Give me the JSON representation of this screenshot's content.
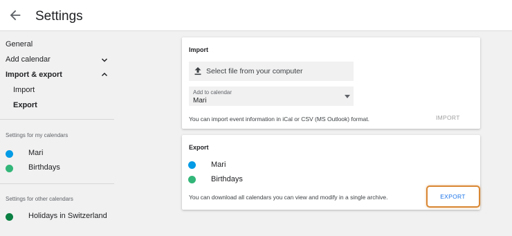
{
  "header": {
    "title": "Settings",
    "back_icon": "arrow-left-icon"
  },
  "sidebar": {
    "items": [
      {
        "label": "General"
      },
      {
        "label": "Add calendar",
        "icon": "chevron-down-icon"
      },
      {
        "label": "Import & export",
        "icon": "chevron-up-icon"
      },
      {
        "label": "Import"
      },
      {
        "label": "Export"
      }
    ],
    "my_calendars": {
      "label": "Settings for my calendars",
      "items": [
        {
          "name": "Mari",
          "color": "#039be5"
        },
        {
          "name": "Birthdays",
          "color": "#33b679"
        }
      ]
    },
    "other_calendars": {
      "label": "Settings for other calendars",
      "items": [
        {
          "name": "Holidays in Switzerland",
          "color": "#0b8043"
        }
      ]
    }
  },
  "import": {
    "title": "Import",
    "file_label": "Select file from your computer",
    "file_icon": "upload-icon",
    "add_to_label": "Add to calendar",
    "add_to_value": "Mari",
    "info": "You can import event information in iCal or CSV (MS Outlook) format.",
    "button": "IMPORT"
  },
  "export": {
    "title": "Export",
    "calendars": [
      {
        "name": "Mari",
        "color": "#039be5"
      },
      {
        "name": "Birthdays",
        "color": "#33b679"
      }
    ],
    "info": "You can download all calendars you can view and modify in a single archive.",
    "button": "EXPORT",
    "highlight_color": "#d98733"
  }
}
